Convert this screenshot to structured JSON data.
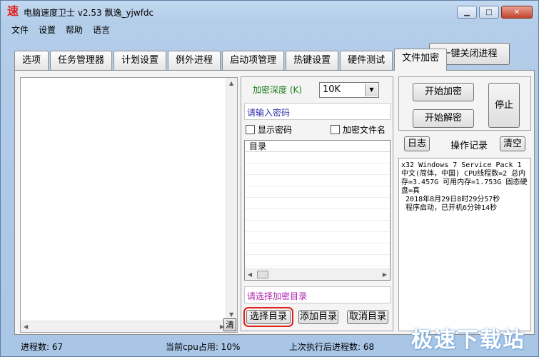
{
  "window": {
    "app_icon": "速",
    "title": "电脑速度卫士 v2.53  飘逸_yjwfdc",
    "minimize_icon": "minimize-icon",
    "maximize_icon": "maximize-icon",
    "close_icon": "close-icon"
  },
  "menu": [
    "文件",
    "设置",
    "帮助",
    "语言"
  ],
  "tabs": [
    "选项",
    "任务管理器",
    "计划设置",
    "例外进程",
    "启动项管理",
    "热键设置",
    "硬件测试",
    "文件加密"
  ],
  "active_tab": "文件加密",
  "close_all_button": "一键关闭进程",
  "left_panel": {
    "clear_button": "清"
  },
  "encrypt": {
    "depth_label": "加密深度 (K)",
    "depth_value": "10K",
    "password_placeholder": "请输入密码",
    "show_password": "显示密码",
    "encrypt_filename": "加密文件名",
    "dir_header": "目录",
    "select_dir_placeholder": "请选择加密目录",
    "select_dir_button": "选择目录",
    "add_dir_button": "添加目录",
    "cancel_dir_button": "取消目录"
  },
  "actions": {
    "start_encrypt": "开始加密",
    "start_decrypt": "开始解密",
    "stop": "停止",
    "log_button": "日志",
    "op_record": "操作记录",
    "clear_button": "清空"
  },
  "log_text": "x32 Windows 7 Service Pack 1 中文(简体，中国) CPU线程数=2 总内存=3.457G 可用内存=1.753G 固态硬盘=真\n 2018年8月29日8时29分57秒\n 程序启动，已开机6分钟14秒",
  "status": {
    "process_count": "进程数: 67",
    "cpu_usage": "当前cpu占用: 10%",
    "last_exec_count": "上次执行后进程数: 68"
  },
  "watermark": "极速下载站",
  "colors": {
    "title_red": "#e0201a",
    "depth_green": "#1b7d1b",
    "highlight_red": "#e0201a"
  }
}
